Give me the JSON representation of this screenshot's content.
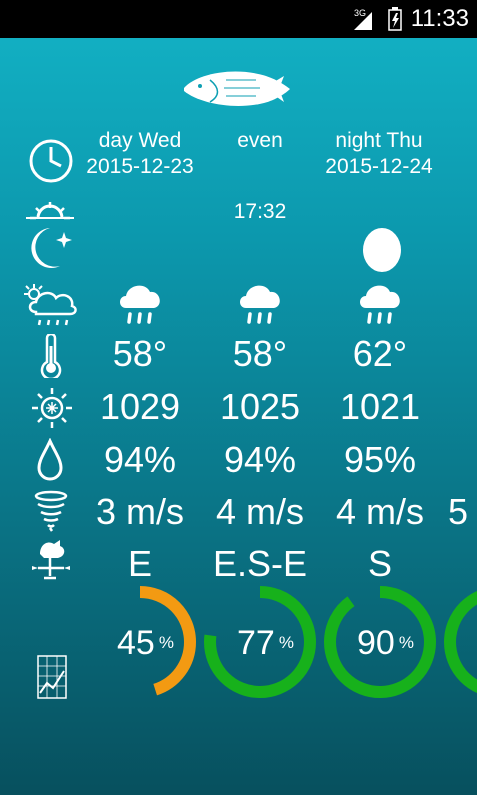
{
  "status_bar": {
    "network": "3G",
    "time": "11:33"
  },
  "header": {
    "col1_day": "day Wed",
    "col1_date": "2015-12-23",
    "col2_label": "even",
    "col3_day": "night Thu",
    "col3_date": "2015-12-24",
    "time": "17:32"
  },
  "columns": [
    {
      "temp": "58°",
      "pressure": "1029",
      "humidity": "94%",
      "wind": "3 m/s",
      "direction": "E",
      "percent": "45",
      "fraction": 0.45,
      "color": "#f39a12"
    },
    {
      "temp": "58°",
      "pressure": "1025",
      "humidity": "94%",
      "wind": "4 m/s",
      "direction": "E.S-E",
      "percent": "77",
      "fraction": 0.77,
      "color": "#17b11b"
    },
    {
      "temp": "62°",
      "pressure": "1021",
      "humidity": "95%",
      "wind": "4 m/s",
      "direction": "S",
      "percent": "90",
      "fraction": 0.9,
      "color": "#17b11b"
    }
  ],
  "percent_sign": "%",
  "icons": [
    "fish-icon",
    "clock-icon",
    "sun-moon-icon",
    "moon-phase-icon",
    "weather-icon",
    "rain-cloud-icon",
    "thermometer-icon",
    "pressure-sun-icon",
    "humidity-drop-icon",
    "tornado-icon",
    "weathervane-icon",
    "chart-icon"
  ]
}
